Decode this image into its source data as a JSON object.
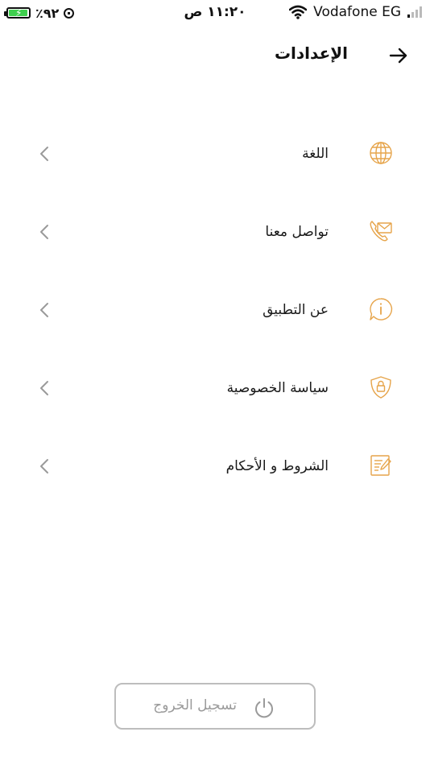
{
  "status_bar": {
    "battery_text": "٪٩٢",
    "time": "١١:٢٠ ص",
    "carrier": "Vodafone EG",
    "battery_level": 0.92
  },
  "header": {
    "title": "الإعدادات",
    "back_icon": "arrow-right-icon"
  },
  "menu": {
    "items": [
      {
        "label": "اللغة",
        "icon": "globe-icon"
      },
      {
        "label": "تواصل معنا",
        "icon": "envelope-phone-icon"
      },
      {
        "label": "عن التطبيق",
        "icon": "info-chat-icon"
      },
      {
        "label": "سياسة الخصوصية",
        "icon": "shield-lock-icon"
      },
      {
        "label": "الشروط و الأحكام",
        "icon": "document-edit-icon"
      }
    ]
  },
  "logout": {
    "label": "تسجيل الخروج",
    "icon": "power-icon"
  },
  "colors": {
    "accent": "#e6a44a",
    "chevron": "#9a9a9a",
    "logout_gray": "#9a9a9a",
    "logout_border": "#bdbdbd",
    "battery_green": "#3fcf4e"
  }
}
